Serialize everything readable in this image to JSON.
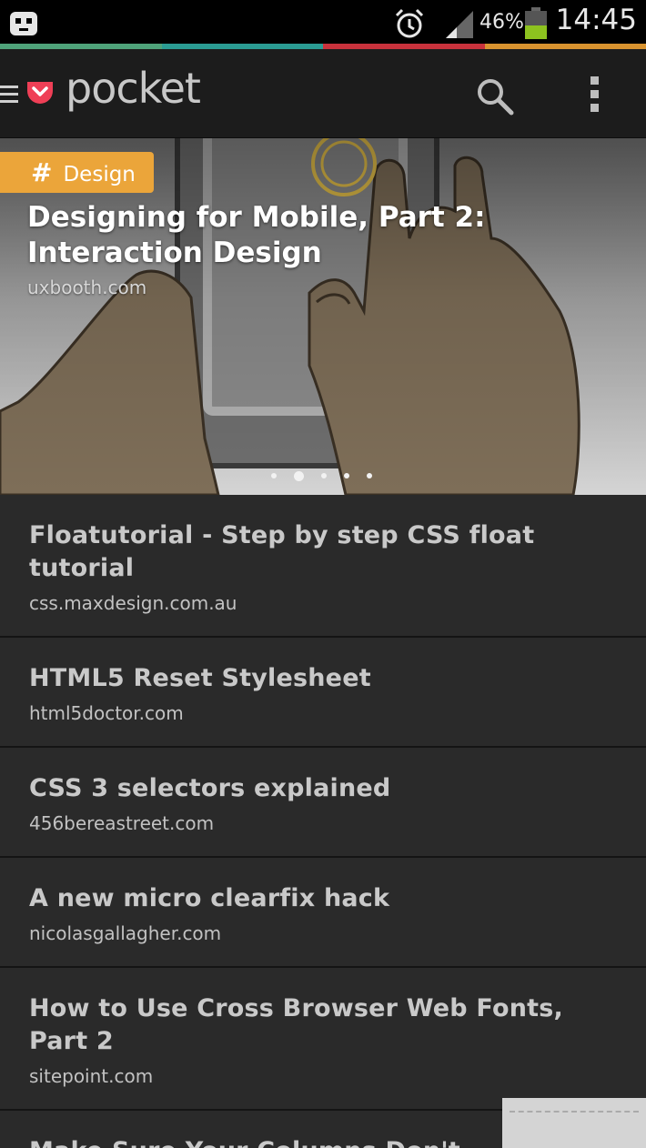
{
  "status_bar": {
    "time": "14:45",
    "battery_percent": "46%",
    "icons": [
      "app-notification-icon",
      "alarm-icon",
      "signal-icon",
      "battery-icon"
    ]
  },
  "color_strip": [
    "#4fa37a",
    "#2b9c93",
    "#c8323c",
    "#d9932f"
  ],
  "app_bar": {
    "logo_text": "pocket",
    "icons": [
      "menu-icon",
      "pocket-logo-icon",
      "search-icon",
      "more-vertical-icon"
    ]
  },
  "featured": {
    "tag": "Design",
    "tag_icon": "#",
    "title": "Designing for Mobile, Part 2: Interaction Design",
    "domain": "uxbooth.com",
    "carousel_count": 5,
    "carousel_active": 2
  },
  "items": [
    {
      "title": "Floatutorial - Step by step CSS float tutorial",
      "domain": "css.maxdesign.com.au"
    },
    {
      "title": "HTML5 Reset Stylesheet",
      "domain": "html5doctor.com"
    },
    {
      "title": "CSS 3 selectors explained",
      "domain": "456bereastreet.com"
    },
    {
      "title": "A new micro clearfix hack",
      "domain": "nicolasgallagher.com"
    },
    {
      "title": "How to Use Cross Browser Web Fonts, Part 2",
      "domain": "sitepoint.com"
    },
    {
      "title": "Make Sure Your Columns Don't",
      "domain": ""
    }
  ],
  "colors": {
    "tag": "#eba53a",
    "logo": "#ef3f56",
    "background": "#2a2a2a",
    "app_bar": "#1c1c1c"
  }
}
